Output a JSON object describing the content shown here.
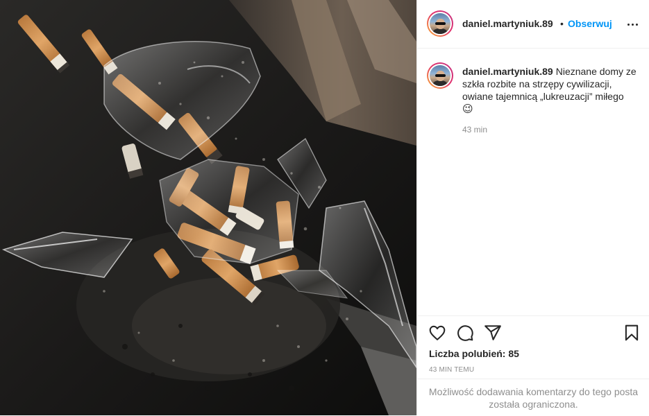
{
  "post": {
    "author": {
      "username": "daniel.martyniuk.89",
      "avatar_icon": "profile-photo"
    },
    "header": {
      "separator": "•",
      "follow_label": "Obserwuj",
      "more_icon": "more-options-icon"
    },
    "caption": {
      "username": "daniel.martyniuk.89",
      "text": "Nieznane domy ze szkła rozbite na strzępy cywilizacji, owiane tajemnicą „lukreuzacji” miłego",
      "emoji": "😉",
      "time": "43 min"
    },
    "actions": {
      "like_icon": "heart-icon",
      "comment_icon": "comment-icon",
      "share_icon": "share-icon",
      "save_icon": "bookmark-icon"
    },
    "likes_text": "Liczba polubień: 85",
    "posted_ago": "43 MIN TEMU",
    "comments_restricted_text": "Możliwość dodawania komentarzy do tego posta została ograniczona."
  },
  "colors": {
    "accent": "#0095f6",
    "text": "#262626",
    "muted": "#8e8e8e",
    "border": "#efefef"
  }
}
